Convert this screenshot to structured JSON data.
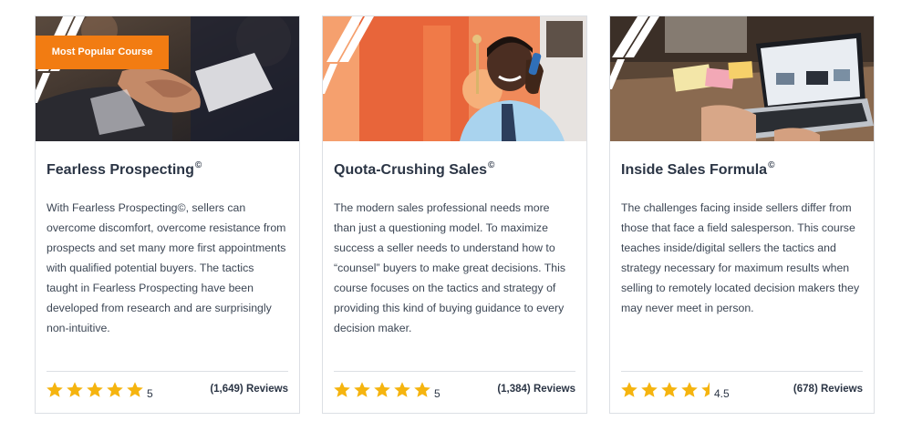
{
  "courses": [
    {
      "badge": "Most Popular Course",
      "title": "Fearless Prospecting",
      "mark": "©",
      "description": "With Fearless Prospecting©, sellers can overcome discomfort, overcome resistance from prospects and set many more first appointments with qualified potential buyers. The tactics taught in Fearless Prospecting have been developed from research and are surprisingly non-intuitive.",
      "rating": 5,
      "rating_label": "5",
      "reviews": "(1,649) Reviews",
      "image": "handshake-photo"
    },
    {
      "badge": "",
      "title": "Quota-Crushing Sales",
      "mark": "©",
      "description": "The modern sales professional needs more than just a questioning model. To maximize success a seller needs to understand how to “counsel” buyers to make great decisions. This course focuses on the tactics and strategy of providing this kind of buying guidance to every decision maker.",
      "rating": 5,
      "rating_label": "5",
      "reviews": "(1,384) Reviews",
      "image": "phone-call-photo"
    },
    {
      "badge": "",
      "title": "Inside Sales Formula",
      "mark": "©",
      "description": "The challenges facing inside sellers differ from those that face a field salesperson. This course teaches inside/digital sellers the tactics and strategy necessary for maximum results when selling to remotely located decision makers they may never meet in person.",
      "rating": 4.5,
      "rating_label": "4.5",
      "reviews": "(678) Reviews",
      "image": "laptop-photo"
    }
  ],
  "colors": {
    "star": "#f5b40f",
    "badge": "#f27c12",
    "text": "#2b3545"
  },
  "icons": {
    "star": "star-icon",
    "half_star": "half-star-icon"
  }
}
